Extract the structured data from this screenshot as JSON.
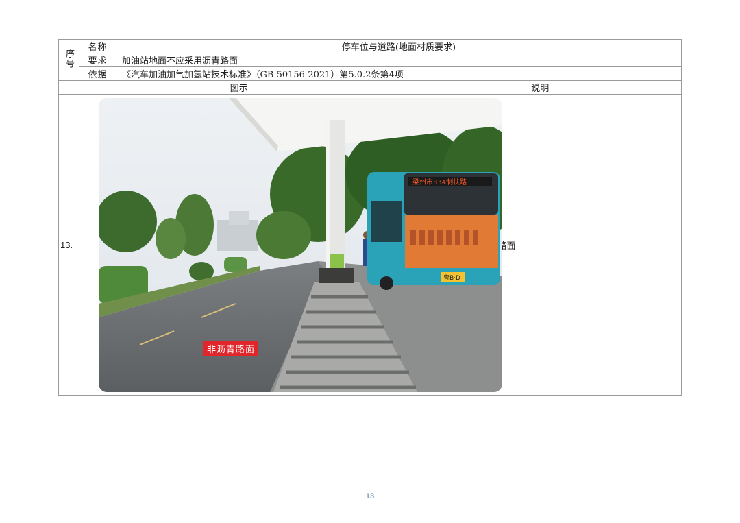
{
  "table": {
    "seq_header": "序号",
    "rows": [
      {
        "key": "名称",
        "value": "停车位与道路(地面材质要求)"
      },
      {
        "key": "要求",
        "value": "加油站地面不应采用沥青路面"
      },
      {
        "key": "依据",
        "value": "《汽车加油加气加氢站技术标准》（GB 50156-2021）第5.0.2条第4项"
      }
    ],
    "col_image_header": "图示",
    "col_desc_header": "说明",
    "item": {
      "number": "13.",
      "photo_label": "非沥青路面",
      "description": "加油站地面不应采用沥青路面"
    }
  },
  "photo": {
    "bus_sign": "梁州市334制扶路",
    "bus_plate": "粤B·D"
  },
  "page_number": "13"
}
